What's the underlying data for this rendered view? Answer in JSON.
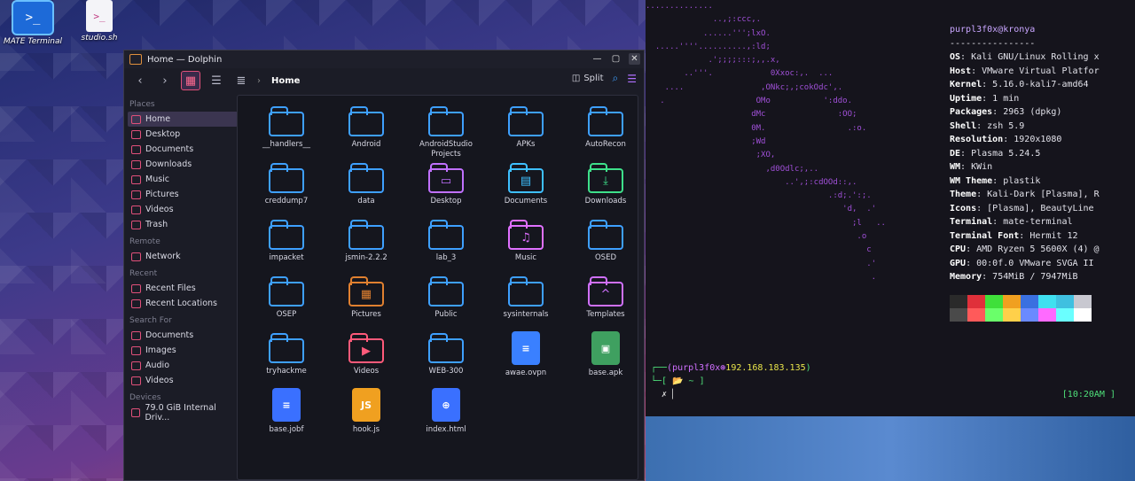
{
  "desktop": {
    "icons": [
      {
        "label": "MATE Terminal"
      },
      {
        "label": "studio.sh"
      }
    ]
  },
  "dolphin": {
    "title": "Home — Dolphin",
    "breadcrumb": "Home",
    "split_label": "Split",
    "sidebar": {
      "places_header": "Places",
      "places": [
        "Home",
        "Desktop",
        "Documents",
        "Downloads",
        "Music",
        "Pictures",
        "Videos",
        "Trash"
      ],
      "remote_header": "Remote",
      "remote": [
        "Network"
      ],
      "recent_header": "Recent",
      "recent": [
        "Recent Files",
        "Recent Locations"
      ],
      "search_header": "Search For",
      "search": [
        "Documents",
        "Images",
        "Audio",
        "Videos"
      ],
      "devices_header": "Devices",
      "devices": [
        "79.0 GiB Internal Driv..."
      ]
    },
    "files": [
      {
        "name": "__handlers__",
        "icon": "folder-icon",
        "color": "#3ea0ff"
      },
      {
        "name": "Android",
        "icon": "folder-icon",
        "color": "#3ea0ff"
      },
      {
        "name": "AndroidStudio Projects",
        "icon": "folder-icon",
        "color": "#3ea0ff"
      },
      {
        "name": "APKs",
        "icon": "folder-icon",
        "color": "#3ea0ff"
      },
      {
        "name": "AutoRecon",
        "icon": "folder-icon",
        "color": "#3ea0ff"
      },
      {
        "name": "creddump7",
        "icon": "folder-icon",
        "color": "#3ea0ff"
      },
      {
        "name": "data",
        "icon": "folder-icon",
        "color": "#3ea0ff"
      },
      {
        "name": "Desktop",
        "icon": "folder-desktop-icon",
        "color": "#c070ff",
        "glyph": "▭"
      },
      {
        "name": "Documents",
        "icon": "folder-documents-icon",
        "color": "#3ec0ff",
        "glyph": "▤"
      },
      {
        "name": "Downloads",
        "icon": "folder-downloads-icon",
        "color": "#3ee08a",
        "glyph": "⤓"
      },
      {
        "name": "impacket",
        "icon": "folder-icon",
        "color": "#3ea0ff"
      },
      {
        "name": "jsmin-2.2.2",
        "icon": "folder-icon",
        "color": "#3ea0ff"
      },
      {
        "name": "lab_3",
        "icon": "folder-icon",
        "color": "#3ea0ff"
      },
      {
        "name": "Music",
        "icon": "folder-music-icon",
        "color": "#e070ff",
        "glyph": "♫"
      },
      {
        "name": "OSED",
        "icon": "folder-icon",
        "color": "#3ea0ff"
      },
      {
        "name": "OSEP",
        "icon": "folder-icon",
        "color": "#3ea0ff"
      },
      {
        "name": "Pictures",
        "icon": "folder-pictures-icon",
        "color": "#e08030",
        "glyph": "▦"
      },
      {
        "name": "Public",
        "icon": "folder-icon",
        "color": "#3ea0ff"
      },
      {
        "name": "sysinternals",
        "icon": "folder-icon",
        "color": "#3ea0ff"
      },
      {
        "name": "Templates",
        "icon": "folder-templates-icon",
        "color": "#d070ff",
        "glyph": "^"
      },
      {
        "name": "tryhackme",
        "icon": "folder-icon",
        "color": "#3ea0ff"
      },
      {
        "name": "Videos",
        "icon": "folder-videos-icon",
        "color": "#ff5a7a",
        "glyph": "▶"
      },
      {
        "name": "WEB-300",
        "icon": "folder-icon",
        "color": "#3ea0ff"
      },
      {
        "name": "awae.ovpn",
        "icon": "document-icon",
        "color": "#3a80ff",
        "glyph": "≡",
        "doc": true
      },
      {
        "name": "base.apk",
        "icon": "apk-icon",
        "color": "#3fa060",
        "glyph": "▣",
        "doc": true
      },
      {
        "name": "base.jobf",
        "icon": "document-icon",
        "color": "#3a70ff",
        "glyph": "≡",
        "doc": true
      },
      {
        "name": "hook.js",
        "icon": "javascript-icon",
        "color": "#f0a020",
        "glyph": "JS",
        "doc": true
      },
      {
        "name": "index.html",
        "icon": "html-icon",
        "color": "#3a70ff",
        "glyph": "⊕",
        "doc": true
      }
    ]
  },
  "terminal": {
    "header": "purpl3f0x@kronya",
    "separator": "----------------",
    "info": [
      {
        "k": "OS",
        "v": "Kali GNU/Linux Rolling x"
      },
      {
        "k": "Host",
        "v": "VMware Virtual Platfor"
      },
      {
        "k": "Kernel",
        "v": "5.16.0-kali7-amd64"
      },
      {
        "k": "Uptime",
        "v": "1 min"
      },
      {
        "k": "Packages",
        "v": "2963 (dpkg)"
      },
      {
        "k": "Shell",
        "v": "zsh 5.9"
      },
      {
        "k": "Resolution",
        "v": "1920x1080"
      },
      {
        "k": "DE",
        "v": "Plasma 5.24.5"
      },
      {
        "k": "WM",
        "v": "KWin"
      },
      {
        "k": "WM Theme",
        "v": "plastik"
      },
      {
        "k": "Theme",
        "v": "Kali-Dark [Plasma], R"
      },
      {
        "k": "Icons",
        "v": "[Plasma], BeautyLine"
      },
      {
        "k": "Terminal",
        "v": "mate-terminal"
      },
      {
        "k": "Terminal Font",
        "v": "Hermit 12"
      },
      {
        "k": "CPU",
        "v": "AMD Ryzen 5 5600X (4) @"
      },
      {
        "k": "GPU",
        "v": "00:0f.0 VMware SVGA II"
      },
      {
        "k": "Memory",
        "v": "754MiB / 7947MiB"
      }
    ],
    "palette": [
      "#2a2a2a",
      "#e0303a",
      "#3fe03a",
      "#f0a020",
      "#3a70e0",
      "#3fe0f0",
      "#3fc0e0",
      "#c8c8d0",
      "#4a4a4a",
      "#ff5a5a",
      "#6aff6a",
      "#ffd04a",
      "#6a8aff",
      "#ff6aff",
      "#6affff",
      "#ffffff"
    ],
    "prompt_user": "(purpl3f0x⊛",
    "prompt_ip": "192.168.183.135",
    "prompt_dir": "[ 📂 ~ ]",
    "clock": "[10:20AM ]"
  }
}
